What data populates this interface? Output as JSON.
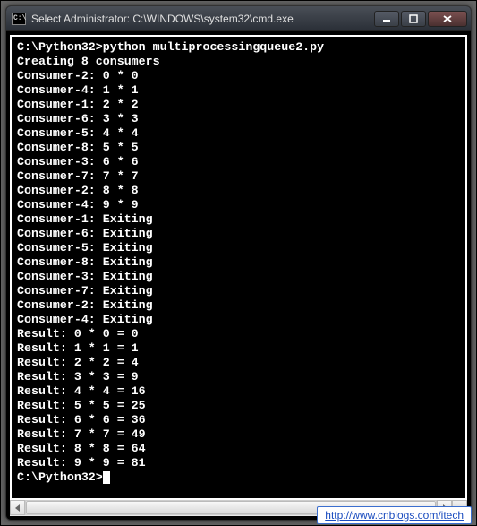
{
  "window": {
    "title": "Select Administrator: C:\\WINDOWS\\system32\\cmd.exe",
    "sysicon_label": "C:\\"
  },
  "terminal": {
    "prompt_path": "C:\\Python32>",
    "command": "python multiprocessingqueue2.py",
    "creating_line": "Creating 8 consumers",
    "tasks": [
      {
        "consumer": "Consumer-2",
        "text": "0 * 0"
      },
      {
        "consumer": "Consumer-4",
        "text": "1 * 1"
      },
      {
        "consumer": "Consumer-1",
        "text": "2 * 2"
      },
      {
        "consumer": "Consumer-6",
        "text": "3 * 3"
      },
      {
        "consumer": "Consumer-5",
        "text": "4 * 4"
      },
      {
        "consumer": "Consumer-8",
        "text": "5 * 5"
      },
      {
        "consumer": "Consumer-3",
        "text": "6 * 6"
      },
      {
        "consumer": "Consumer-7",
        "text": "7 * 7"
      },
      {
        "consumer": "Consumer-2",
        "text": "8 * 8"
      },
      {
        "consumer": "Consumer-4",
        "text": "9 * 9"
      }
    ],
    "exiting": [
      "Consumer-1",
      "Consumer-6",
      "Consumer-5",
      "Consumer-8",
      "Consumer-3",
      "Consumer-7",
      "Consumer-2",
      "Consumer-4"
    ],
    "exiting_word": "Exiting",
    "results_label": "Result",
    "results": [
      {
        "expr": "0 * 0",
        "value": 0
      },
      {
        "expr": "1 * 1",
        "value": 1
      },
      {
        "expr": "2 * 2",
        "value": 4
      },
      {
        "expr": "3 * 3",
        "value": 9
      },
      {
        "expr": "4 * 4",
        "value": 16
      },
      {
        "expr": "5 * 5",
        "value": 25
      },
      {
        "expr": "6 * 6",
        "value": 36
      },
      {
        "expr": "7 * 7",
        "value": 49
      },
      {
        "expr": "8 * 8",
        "value": 64
      },
      {
        "expr": "9 * 9",
        "value": 81
      }
    ],
    "final_prompt": "C:\\Python32>"
  },
  "watermark": {
    "url_text": "http://www.cnblogs.com/itech"
  }
}
